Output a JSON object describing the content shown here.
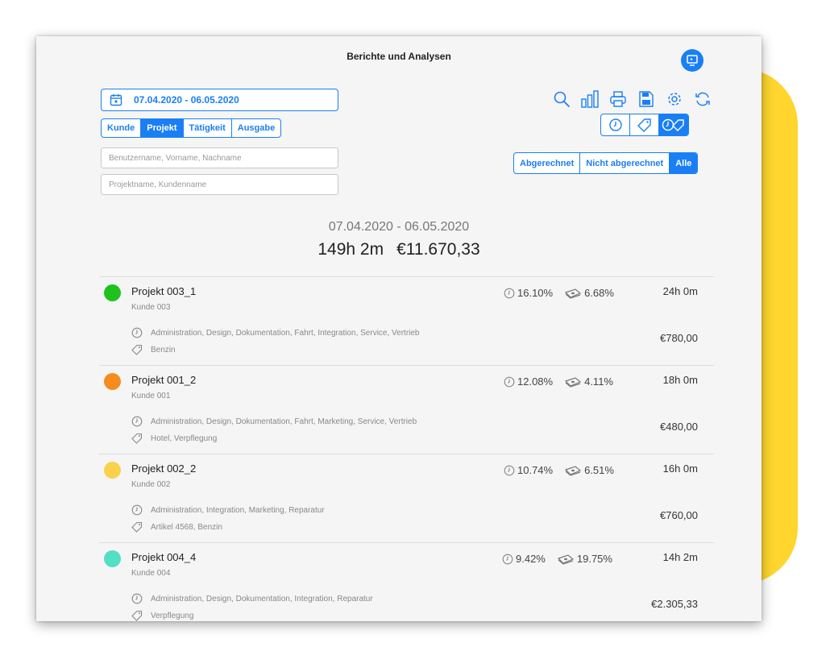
{
  "window": {
    "title": "Berichte und Analysen"
  },
  "date_button": {
    "label": "07.04.2020 - 06.05.2020"
  },
  "tabs": [
    "Kunde",
    "Projekt",
    "Tätigkeit",
    "Ausgabe"
  ],
  "tabs_active": 1,
  "filters": {
    "user_placeholder": "Benutzername, Vorname, Nachname",
    "project_placeholder": "Projektname, Kundenname"
  },
  "billing": [
    "Abgerechnet",
    "Nicht abgerechnet",
    "Alle"
  ],
  "billing_active": 2,
  "toolbar_icons": [
    "search-icon",
    "bar-chart-icon",
    "printer-icon",
    "save-icon",
    "gear-icon",
    "refresh-icon"
  ],
  "type_toggle_icons": [
    "clock-icon",
    "tag-icon",
    "clock-tag-icon"
  ],
  "type_toggle_active": 2,
  "summary": {
    "range": "07.04.2020 - 06.05.2020",
    "hours": "149h 2m",
    "amount": "€11.670,33"
  },
  "colors": {
    "accent": "#1a7ff5",
    "highlight": "#FFD52E"
  },
  "projects": [
    {
      "name": "Projekt 003_1",
      "client": "Kunde 003",
      "color": "#1ec21e",
      "time_pct": "16.10%",
      "expense_pct": "6.68%",
      "hours": "24h 0m",
      "amount": "€780,00",
      "tasks": "Administration, Design, Dokumentation, Fahrt, Integration, Service, Vertrieb",
      "expenses": "Benzin"
    },
    {
      "name": "Projekt 001_2",
      "client": "Kunde 001",
      "color": "#f68b1f",
      "time_pct": "12.08%",
      "expense_pct": "4.11%",
      "hours": "18h 0m",
      "amount": "€480,00",
      "tasks": "Administration, Design, Dokumentation, Fahrt, Marketing, Service, Vertrieb",
      "expenses": "Hotel, Verpflegung"
    },
    {
      "name": "Projekt 002_2",
      "client": "Kunde 002",
      "color": "#fbd14b",
      "time_pct": "10.74%",
      "expense_pct": "6.51%",
      "hours": "16h 0m",
      "amount": "€760,00",
      "tasks": "Administration, Integration, Marketing, Reparatur",
      "expenses": "Artikel 4568, Benzin"
    },
    {
      "name": "Projekt 004_4",
      "client": "Kunde 004",
      "color": "#53dfc2",
      "time_pct": "9.42%",
      "expense_pct": "19.75%",
      "hours": "14h 2m",
      "amount": "€2.305,33",
      "tasks": "Administration, Design, Dokumentation, Integration, Reparatur",
      "expenses": "Verpflegung"
    }
  ]
}
